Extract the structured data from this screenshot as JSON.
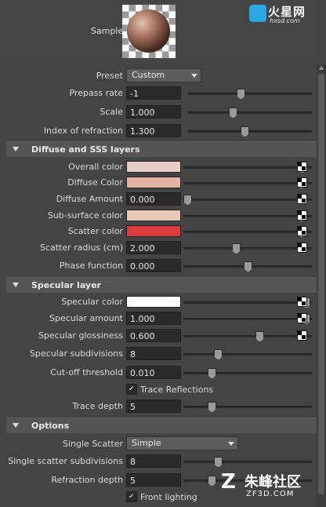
{
  "sample": {
    "label": "Sample"
  },
  "watermark_top": {
    "big": "火星网",
    "small": "hxsd.com"
  },
  "watermark_bottom": {
    "cn": "朱峰社区",
    "en": "ZF3D.COM"
  },
  "basic": {
    "preset": {
      "label": "Preset",
      "value": "Custom"
    },
    "prepass_rate": {
      "label": "Prepass rate",
      "value": "-1",
      "slider": 0.42
    },
    "scale": {
      "label": "Scale",
      "value": "1.000",
      "slider": 0.35
    },
    "ior": {
      "label": "Index of refraction",
      "value": "1.300",
      "slider": 0.45
    }
  },
  "diffuse_section": {
    "title": "Diffuse and SSS layers",
    "overall_color": {
      "label": "Overall color",
      "color": "#e8cdc6",
      "slider": 0.95
    },
    "diffuse_color": {
      "label": "Diffuse Color",
      "color": "#e3b4a3",
      "slider": 0.94
    },
    "diffuse_amount": {
      "label": "Diffuse Amount",
      "value": "0.000",
      "slider": 0.0
    },
    "subsurface_color": {
      "label": "Sub-surface color",
      "color": "#e7c8b7",
      "slider": 0.94
    },
    "scatter_color": {
      "label": "Scatter color",
      "color": "#dd3b3d",
      "slider": 0.94
    },
    "scatter_radius": {
      "label": "Scatter radius (cm)",
      "value": "2.000",
      "slider": 0.4
    },
    "phase_function": {
      "label": "Phase function",
      "value": "0.000",
      "slider": 0.5
    }
  },
  "specular_section": {
    "title": "Specular layer",
    "specular_color": {
      "label": "Specular color",
      "color": "#ffffff",
      "slider": 0.98
    },
    "specular_amount": {
      "label": "Specular amount",
      "value": "1.000",
      "slider": 0.98
    },
    "specular_glossiness": {
      "label": "Specular glossiness",
      "value": "0.600",
      "slider": 0.6
    },
    "specular_subdivisions": {
      "label": "Specular subdivisions",
      "value": "8",
      "slider": 0.25
    },
    "cutoff_threshold": {
      "label": "Cut-off threshold",
      "value": "0.010",
      "slider": 0.2
    },
    "trace_reflections": {
      "label": "Trace Reflections",
      "checked": true
    },
    "trace_depth": {
      "label": "Trace depth",
      "value": "5",
      "slider": 0.2
    }
  },
  "options_section": {
    "title": "Options",
    "single_scatter": {
      "label": "Single Scatter",
      "value": "Simple"
    },
    "single_scatter_subdivisions": {
      "label": "Single scatter subdivisions",
      "value": "8",
      "slider": 0.25
    },
    "refraction_depth": {
      "label": "Refraction depth",
      "value": "5",
      "slider": 0.2
    },
    "front_lighting": {
      "label": "Front lighting",
      "checked": true
    }
  }
}
